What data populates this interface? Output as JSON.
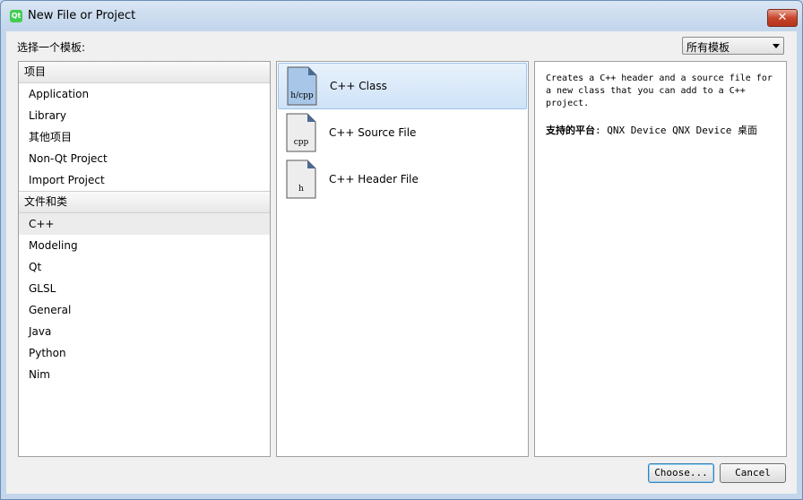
{
  "window": {
    "title": "New File or Project",
    "close_glyph": "✕",
    "app_icon_text": "Qt"
  },
  "filter": {
    "label": "选择一个模板:",
    "selected": "所有模板"
  },
  "categories": {
    "groups": [
      {
        "header": "项目",
        "items": [
          "Application",
          "Library",
          "其他项目",
          "Non-Qt Project",
          "Import Project"
        ]
      },
      {
        "header": "文件和类",
        "items": [
          "C++",
          "Modeling",
          "Qt",
          "GLSL",
          "General",
          "Java",
          "Python",
          "Nim"
        ]
      }
    ],
    "selected_item": "C++"
  },
  "templates": [
    {
      "label": "C++ Class",
      "icon_text": "h/cpp",
      "selected": true,
      "icon_fill": "#a8c6e8"
    },
    {
      "label": "C++ Source File",
      "icon_text": "cpp",
      "selected": false,
      "icon_fill": "#ededed"
    },
    {
      "label": "C++ Header File",
      "icon_text": "h",
      "selected": false,
      "icon_fill": "#ededed"
    }
  ],
  "details": {
    "description": "Creates a C++ header and a source file for a new class that you can add to a C++ project.",
    "platforms_label": "支持的平台",
    "platforms_value": ": QNX Device QNX Device 桌面"
  },
  "buttons": {
    "choose": "Choose...",
    "cancel": "Cancel"
  },
  "colors": {
    "selection": "#cfe3f8",
    "title_bar": "#c3d6ec",
    "close": "#c8452c",
    "icon_accent": "#4a6a94"
  }
}
